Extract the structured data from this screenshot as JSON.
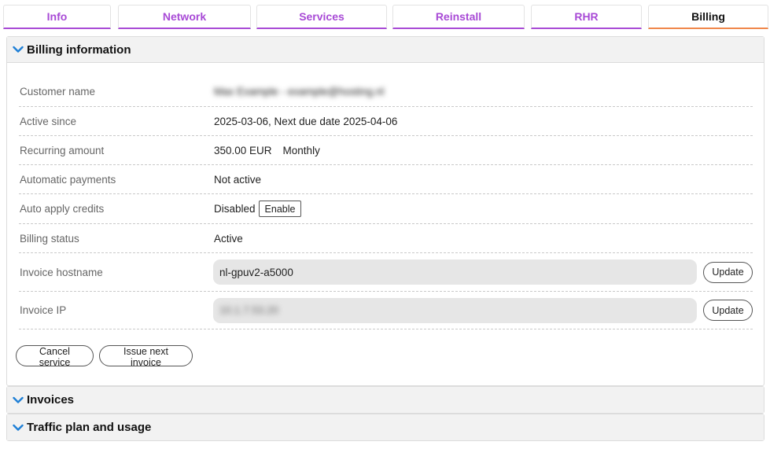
{
  "tabs": [
    {
      "label": "Info",
      "active": false
    },
    {
      "label": "Network",
      "active": false
    },
    {
      "label": "Services",
      "active": false
    },
    {
      "label": "Reinstall",
      "active": false
    },
    {
      "label": "RHR",
      "active": false
    },
    {
      "label": "Billing",
      "active": true
    }
  ],
  "colors": {
    "tab_accent": "#a84ad6",
    "active_tab_underline": "#f0874a",
    "chevron": "#1e7fd6"
  },
  "billing": {
    "title": "Billing information",
    "expanded": true,
    "rows": {
      "customer_name": {
        "label": "Customer name",
        "value": "Max Example - example@hosting.nl"
      },
      "active_since": {
        "label": "Active since",
        "value": "2025-03-06, Next due date 2025-04-06"
      },
      "recurring_amount": {
        "label": "Recurring amount",
        "amount": "350.00 EUR",
        "period": "Monthly"
      },
      "automatic_payments": {
        "label": "Automatic payments",
        "value": "Not active"
      },
      "auto_apply_credits": {
        "label": "Auto apply credits",
        "value": "Disabled",
        "button": "Enable"
      },
      "billing_status": {
        "label": "Billing status",
        "value": "Active"
      },
      "invoice_hostname": {
        "label": "Invoice hostname",
        "value": "nl-gpuv2-a5000",
        "button": "Update"
      },
      "invoice_ip": {
        "label": "Invoice IP",
        "value": "10.1.7.53.20",
        "button": "Update"
      }
    },
    "actions": {
      "cancel_service": "Cancel service",
      "issue_next_invoice": "Issue next invoice"
    }
  },
  "invoices": {
    "title": "Invoices",
    "expanded": false
  },
  "traffic": {
    "title": "Traffic plan and usage",
    "expanded": false
  }
}
